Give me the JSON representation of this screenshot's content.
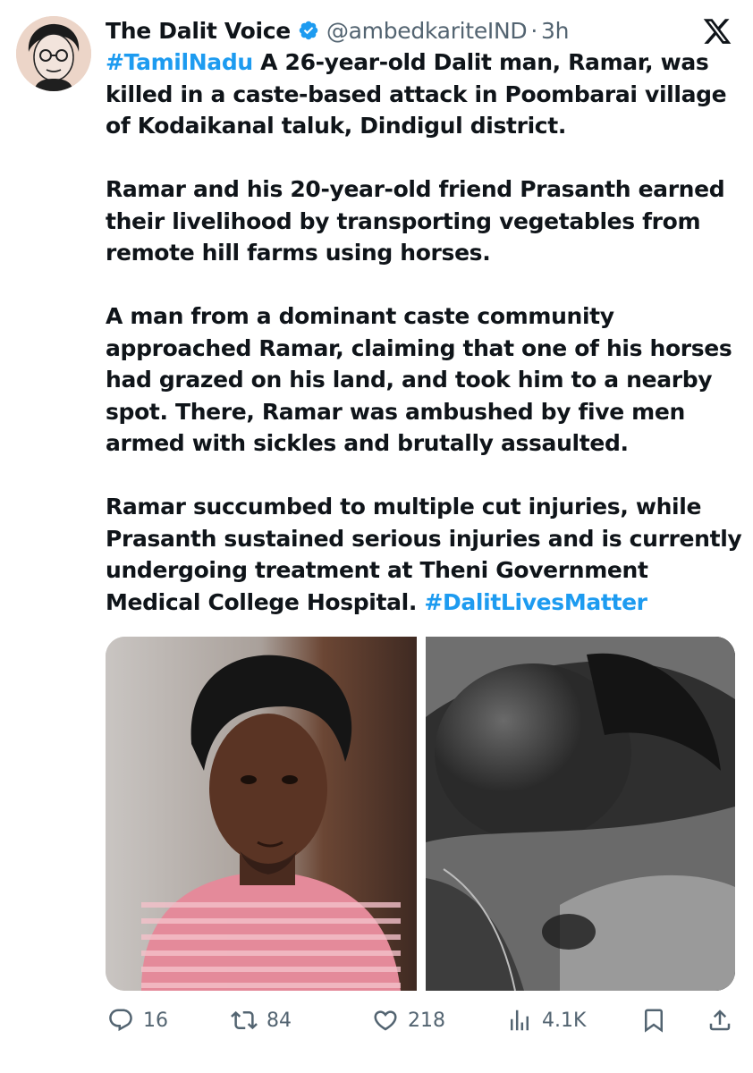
{
  "author": {
    "name": "The Dalit Voice",
    "handle": "@ambedkariteIND",
    "separator": "·",
    "time": "3h",
    "verified_color": "#1d9bf0"
  },
  "tweet": {
    "paragraph1_hashtag": "#TamilNadu",
    "paragraph1_text": " A 26-year-old Dalit man, Ramar, was killed in a caste-based attack in Poombarai village of Kodaikanal taluk, Dindigul district.",
    "paragraph2": "Ramar and his 20-year-old friend Prasanth earned their livelihood by transporting vegetables from remote hill farms using horses.",
    "paragraph3": "A man from a dominant caste community approached Ramar, claiming that one of his horses had grazed on his land, and took him to a nearby spot. There, Ramar was ambushed by five men armed with sickles and brutally assaulted.",
    "paragraph4_text": "Ramar succumbed to multiple cut injuries, while Prasanth sustained serious injuries and is currently undergoing treatment at Theni Government Medical College Hospital. ",
    "paragraph4_hashtag": "#DalitLivesMatter",
    "hashtag_color": "#1d9bf0"
  },
  "media": {
    "images": [
      {
        "icon": "photo-portrait-young-man"
      },
      {
        "icon": "photo-blurred-injured-person"
      }
    ]
  },
  "actions": {
    "reply_count": "16",
    "retweet_count": "84",
    "like_count": "218",
    "views_count": "4.1K",
    "icon_color": "#536471"
  }
}
